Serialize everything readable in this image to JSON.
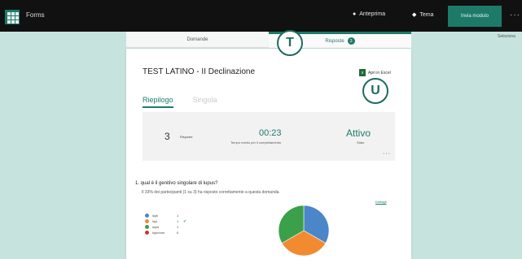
{
  "app": {
    "name": "Forms"
  },
  "toolbar": {
    "preview_label": "Anteprima",
    "theme_label": "Tema",
    "send_label": "Invia modulo",
    "more_label": "···"
  },
  "select_label": "Seleziona",
  "tabs": [
    {
      "label": "Domande"
    },
    {
      "label": "Risposte",
      "badge": "3"
    }
  ],
  "markers": {
    "t": "T",
    "u": "U"
  },
  "form": {
    "title": "TEST LATINO - II Declinazione",
    "excel_label": "Apri in Excel"
  },
  "subtabs": [
    "Riepilogo",
    "Singola"
  ],
  "stats": {
    "count": "3",
    "count_label": "Risposte",
    "time": "00:23",
    "time_label": "Tempo medio per il completamento",
    "status": "Attivo",
    "status_label": "Stato",
    "more": "···"
  },
  "question": {
    "title": "1.  qual è il genitivo singolare di lupus?",
    "subtitle": "Il 33% dei partecipanti (1 su 3) ha risposto correttamente a questa domanda.",
    "details_label": "Dettagli"
  },
  "colors": {
    "accent": "#1d7a69",
    "series": [
      "#4a86c8",
      "#f28a30",
      "#3aa04a",
      "#d6322e"
    ]
  },
  "chart_data": {
    "type": "pie",
    "categories": [
      "lupii",
      "lupi",
      "lupis",
      "lupiorum"
    ],
    "values": [
      1,
      1,
      1,
      0
    ],
    "correct": "lupi"
  }
}
